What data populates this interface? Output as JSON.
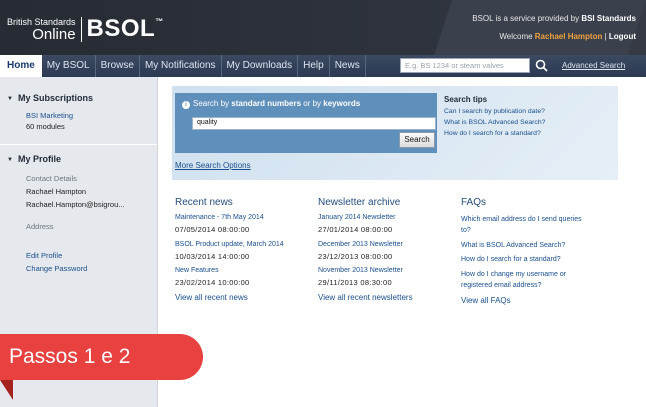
{
  "header": {
    "logo_small": "British Standards",
    "logo_online": "Online",
    "logo_big": "BSOL",
    "logo_tm": "™",
    "service_prefix": "BSOL is a service provided by ",
    "service_brand": "BSI Standards",
    "welcome_prefix": "Welcome ",
    "user_name": "Rachael Hampton",
    "separator": " | ",
    "logout": "Logout"
  },
  "nav": {
    "items": [
      "Home",
      "My BSOL",
      "Browse",
      "My Notifications",
      "My Downloads",
      "Help",
      "News"
    ],
    "search_placeholder": "E.g. BS 1234 or steam valves",
    "search_icon": "search-icon",
    "advanced_search": "Advanced Search"
  },
  "sidebar": {
    "subscriptions_title": "My Subscriptions",
    "subscription_name": "BSI Marketing",
    "subscription_modules": "60 modules",
    "profile_title": "My Profile",
    "contact_details_label": "Contact Details",
    "contact_name": "Rachael Hampton",
    "contact_email": "Rachael.Hampton@bsigrou...",
    "address_label": "Address",
    "edit_profile": "Edit Profile",
    "change_password": "Change Password"
  },
  "search": {
    "hint_prefix": "Search by ",
    "hint_bold1": "standard numbers",
    "hint_middle": " or by ",
    "hint_bold2": "keywords",
    "query": "quality",
    "button": "Search",
    "more_options": "More Search Options",
    "tips_title": "Search tips",
    "tips": [
      "Can I search by publication date?",
      "What is BSOL Advanced Search?",
      "How do I search for a standard?"
    ]
  },
  "recent_news": {
    "title": "Recent news",
    "items": [
      {
        "title": "Maintenance - 7th May 2014",
        "date": "07/05/2014 08:00:00"
      },
      {
        "title": "BSOL Product update, March 2014",
        "date": "10/03/2014 14:00:00"
      },
      {
        "title": "New Features",
        "date": "23/02/2014 10:00:00"
      }
    ],
    "view_all": "View all recent news"
  },
  "newsletters": {
    "title": "Newsletter archive",
    "items": [
      {
        "title": "January 2014 Newsletter",
        "date": "27/01/2014 08:00:00"
      },
      {
        "title": "December 2013 Newsletter",
        "date": "23/12/2013 08:00:00"
      },
      {
        "title": "November 2013 Newsletter",
        "date": "29/11/2013 08:30:00"
      }
    ],
    "view_all": "View all recent newsletters"
  },
  "faqs": {
    "title": "FAQs",
    "items": [
      "Which email address do I send queries",
      "to?",
      "What is BSOL Advanced Search?",
      "How do I search for a standard?",
      "How do I change my username or",
      "registered email address?"
    ],
    "view_all": "View all FAQs"
  },
  "overlay": {
    "banner": "Passos 1 e 2",
    "color": "#e8413f"
  }
}
